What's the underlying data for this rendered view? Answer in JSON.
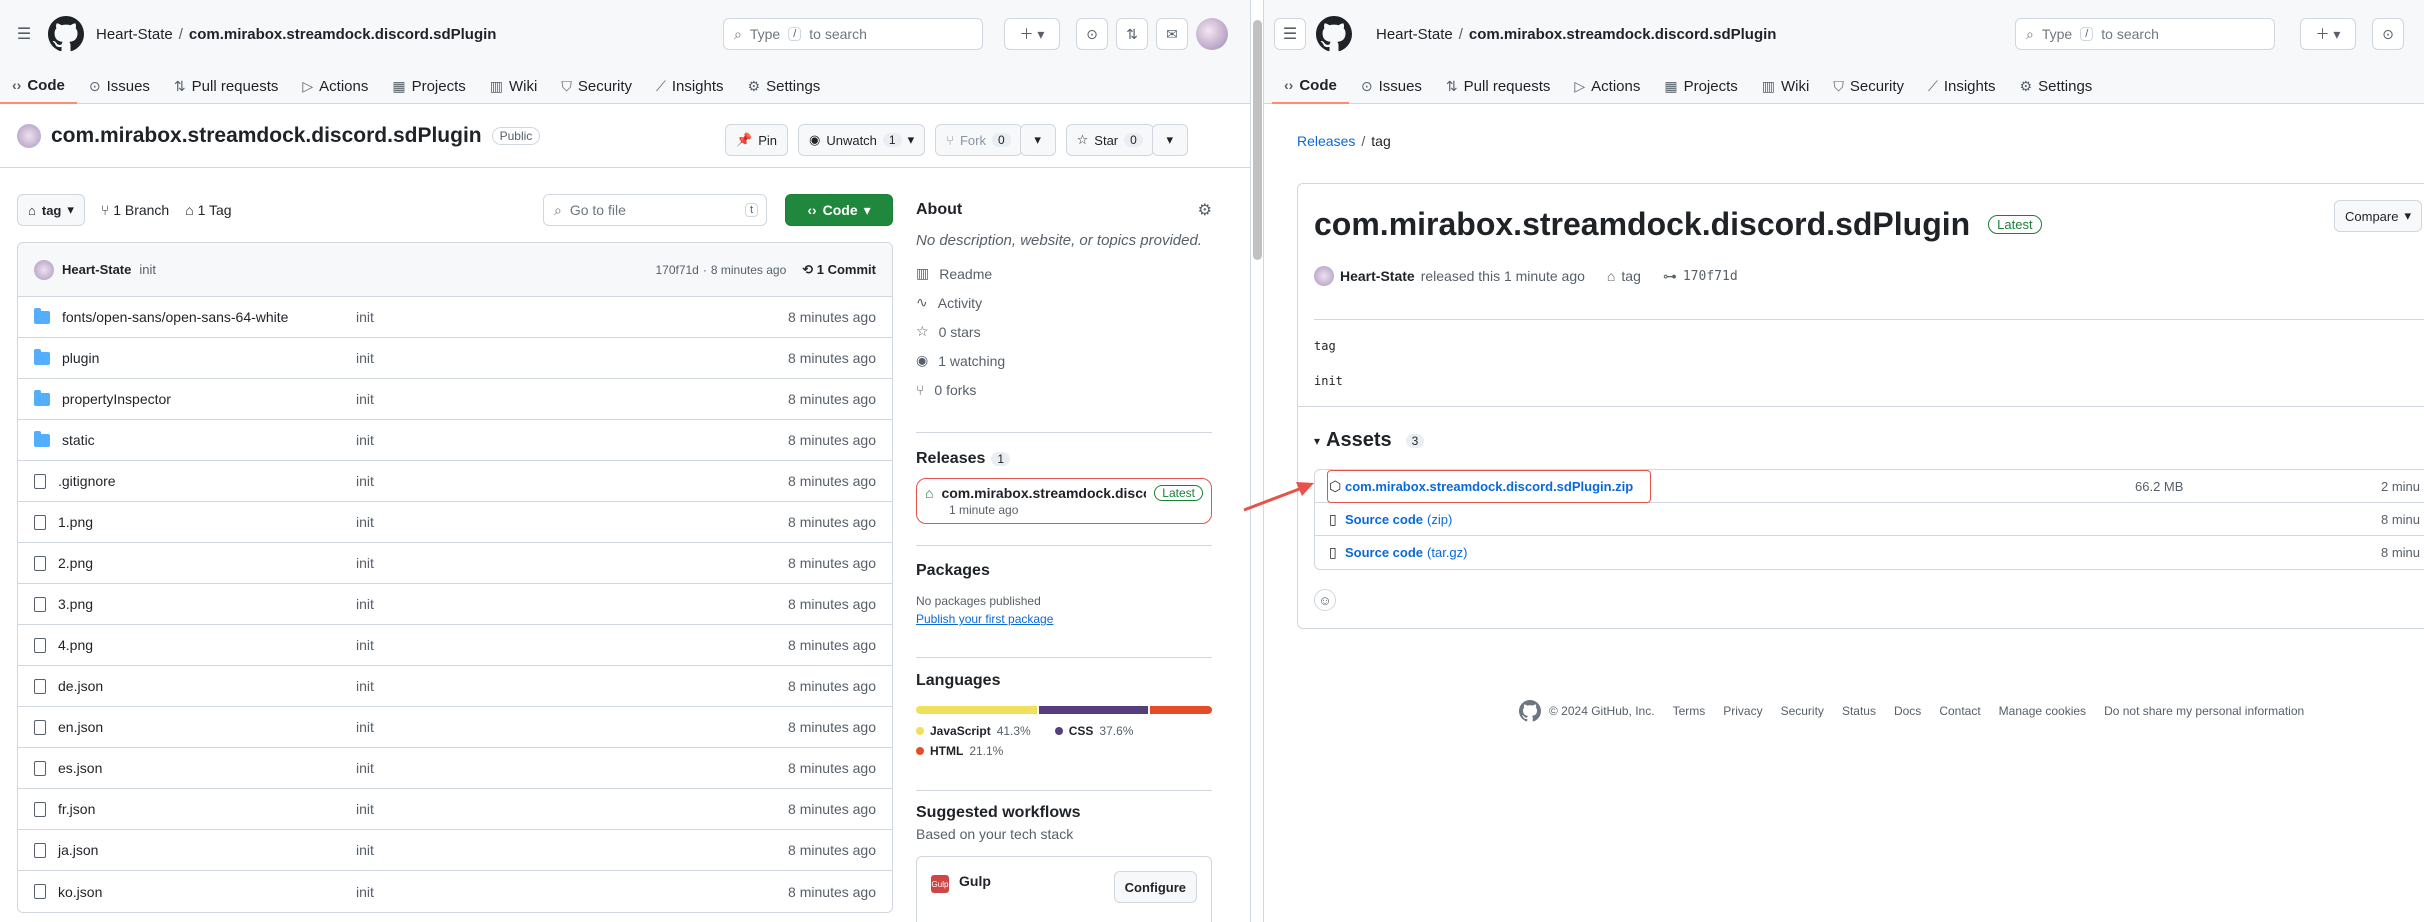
{
  "left": {
    "breadcrumb": {
      "owner": "Heart-State",
      "repo": "com.mirabox.streamdock.discord.sdPlugin"
    },
    "search": {
      "label": "Type",
      "slash": "/",
      "tail": "to search"
    },
    "tabs": [
      "Code",
      "Issues",
      "Pull requests",
      "Actions",
      "Projects",
      "Wiki",
      "Security",
      "Insights",
      "Settings"
    ],
    "repo": {
      "name": "com.mirabox.streamdock.discord.sdPlugin",
      "visibility": "Public",
      "pin": "Pin",
      "unwatch": "Unwatch",
      "watch_count": "1",
      "fork": "Fork",
      "fork_count": "0",
      "star": "Star",
      "star_count": "0"
    },
    "branch": {
      "name": "tag",
      "branches": "1 Branch",
      "tags": "1 Tag",
      "goto": "Go to file",
      "goto_key": "t",
      "code": "Code"
    },
    "commit": {
      "author": "Heart-State",
      "message": "init",
      "hash": "170f71d",
      "age": "8 minutes ago",
      "commits": "1 Commit"
    },
    "files": [
      {
        "name": "fonts/open-sans/open-sans-64-white",
        "type": "dir",
        "msg": "init",
        "age": "8 minutes ago"
      },
      {
        "name": "plugin",
        "type": "dir",
        "msg": "init",
        "age": "8 minutes ago"
      },
      {
        "name": "propertyInspector",
        "type": "dir",
        "msg": "init",
        "age": "8 minutes ago"
      },
      {
        "name": "static",
        "type": "dir",
        "msg": "init",
        "age": "8 minutes ago"
      },
      {
        "name": ".gitignore",
        "type": "file",
        "msg": "init",
        "age": "8 minutes ago"
      },
      {
        "name": "1.png",
        "type": "file",
        "msg": "init",
        "age": "8 minutes ago"
      },
      {
        "name": "2.png",
        "type": "file",
        "msg": "init",
        "age": "8 minutes ago"
      },
      {
        "name": "3.png",
        "type": "file",
        "msg": "init",
        "age": "8 minutes ago"
      },
      {
        "name": "4.png",
        "type": "file",
        "msg": "init",
        "age": "8 minutes ago"
      },
      {
        "name": "de.json",
        "type": "file",
        "msg": "init",
        "age": "8 minutes ago"
      },
      {
        "name": "en.json",
        "type": "file",
        "msg": "init",
        "age": "8 minutes ago"
      },
      {
        "name": "es.json",
        "type": "file",
        "msg": "init",
        "age": "8 minutes ago"
      },
      {
        "name": "fr.json",
        "type": "file",
        "msg": "init",
        "age": "8 minutes ago"
      },
      {
        "name": "ja.json",
        "type": "file",
        "msg": "init",
        "age": "8 minutes ago"
      },
      {
        "name": "ko.json",
        "type": "file",
        "msg": "init",
        "age": "8 minutes ago"
      }
    ],
    "about": {
      "title": "About",
      "desc": "No description, website, or topics provided.",
      "items": [
        "Readme",
        "Activity",
        "0 stars",
        "1 watching",
        "0 forks"
      ]
    },
    "releases": {
      "title": "Releases",
      "count": "1",
      "name": "com.mirabox.streamdock.discor...",
      "badge": "Latest",
      "time": "1 minute ago"
    },
    "packages": {
      "title": "Packages",
      "none": "No packages published",
      "publish": "Publish your first package"
    },
    "languages": {
      "title": "Languages",
      "list": [
        {
          "name": "JavaScript",
          "pct": "41.3%",
          "share": 41.3,
          "color": "#f1e05a"
        },
        {
          "name": "CSS",
          "pct": "37.6%",
          "share": 37.6,
          "color": "#563d7c"
        },
        {
          "name": "HTML",
          "pct": "21.1%",
          "share": 21.1,
          "color": "#e34c26"
        }
      ]
    },
    "workflows": {
      "title": "Suggested workflows",
      "sub": "Based on your tech stack",
      "name": "Gulp",
      "configure": "Configure"
    }
  },
  "right": {
    "breadcrumb": {
      "owner": "Heart-State",
      "repo": "com.mirabox.streamdock.discord.sdPlugin"
    },
    "search": {
      "label": "Type",
      "slash": "/",
      "tail": "to search"
    },
    "tabs": [
      "Code",
      "Issues",
      "Pull requests",
      "Actions",
      "Projects",
      "Wiki",
      "Security",
      "Insights",
      "Settings"
    ],
    "crumbs": {
      "releases": "Releases",
      "tag": "tag"
    },
    "release": {
      "title": "com.mirabox.streamdock.discord.sdPlugin",
      "badge": "Latest",
      "compare": "Compare",
      "author": "Heart-State",
      "action": "released this 1 minute ago",
      "tag": "tag",
      "commit": "170f71d",
      "body1": "tag",
      "body2": "init"
    },
    "assets": {
      "title": "Assets",
      "count": "3",
      "items": [
        {
          "name": "com.mirabox.streamdock.discord.sdPlugin.zip",
          "size": "66.2 MB",
          "time": "2 minu"
        },
        {
          "name": "Source code",
          "ext": "(zip)",
          "time": "8 minu"
        },
        {
          "name": "Source code",
          "ext": "(tar.gz)",
          "time": "8 minu"
        }
      ]
    },
    "footer": {
      "copy": "© 2024 GitHub, Inc.",
      "links": [
        "Terms",
        "Privacy",
        "Security",
        "Status",
        "Docs",
        "Contact",
        "Manage cookies",
        "Do not share my personal information"
      ]
    }
  }
}
